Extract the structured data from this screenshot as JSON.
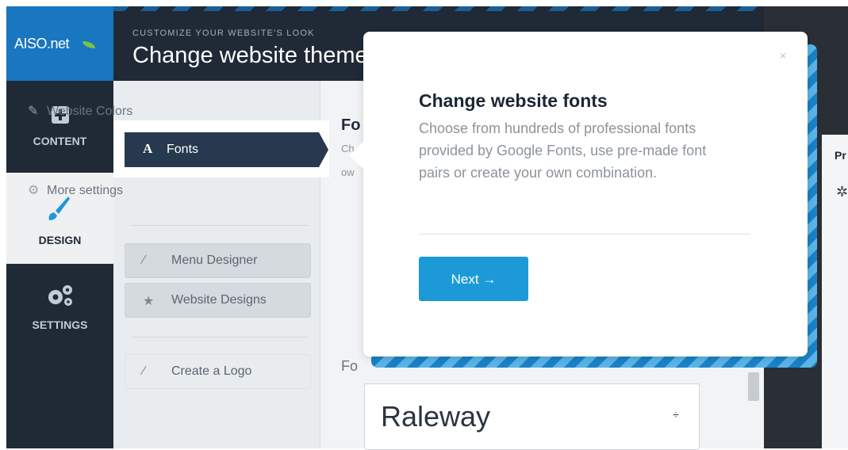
{
  "brand": {
    "logo_text": "AISO.net"
  },
  "header": {
    "subtitle": "CUSTOMIZE YOUR WEBSITE'S LOOK",
    "title": "Change website theme"
  },
  "rail": {
    "content_label": "CONTENT",
    "design_label": "DESIGN",
    "settings_label": "SETTINGS"
  },
  "sidebar": {
    "website_colors": "Website Colors",
    "fonts": "Fonts",
    "fonts_glyph": "A",
    "more_settings": "More settings",
    "menu_designer": "Menu Designer",
    "website_designs": "Website Designs",
    "create_logo": "Create a Logo"
  },
  "main": {
    "section_title": "Fo",
    "line1": "Ch",
    "line2": "ow",
    "font_label": "Fo",
    "font_select_value": "Raleway",
    "select_arrow": "÷"
  },
  "rightpanel": {
    "label": "Pr"
  },
  "popup": {
    "title": "Change website fonts",
    "description": "Choose from hundreds of professional fonts provided by Google Fonts, use pre-made font pairs or create your own combination.",
    "next_label": "Next →",
    "close": "×"
  },
  "colors": {
    "accent": "#1c9ad8",
    "dark": "#1f2a36",
    "active": "#26394f"
  }
}
